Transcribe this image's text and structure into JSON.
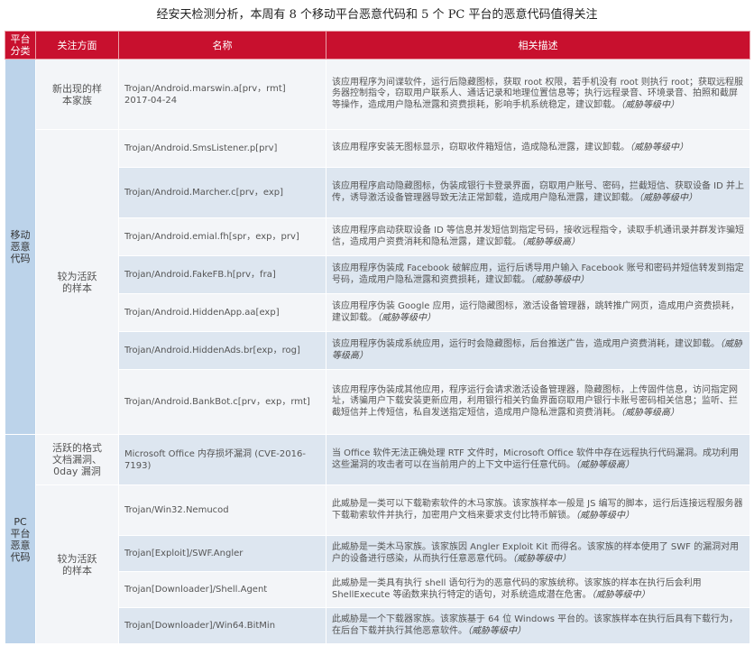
{
  "caption": "经安天检测分析，本周有 8 个移动平台恶意代码和 5 个 PC 平台的恶意代码值得关注",
  "headers": {
    "platform": "平台\n分类",
    "focus": "关注方面",
    "name": "名称",
    "desc": "相关描述"
  },
  "groups": {
    "mobile": "移动\n恶意\n代码",
    "pc": "PC\n平台\n恶意\n代码"
  },
  "focus": {
    "mobile_new": "新出现的样\n本家族",
    "mobile_active": "较为活跃\n的样本",
    "pc_vuln": "活跃的格式\n文档漏洞、\n0day 漏洞",
    "pc_active": "较为活跃\n的样本"
  },
  "rows": [
    {
      "name": "Trojan/Android.marswin.a[prv，rmt]\n2017-04-24",
      "desc": "该应用程序为间谍软件，运行后隐藏图标，获取 root 权限，若手机没有 root 则执行 root；获取远程服务器控制指令，窃取用户联系人、通话记录和地理位置信息等；执行远程录音、环境录音、拍照和截屏等操作，造成用户隐私泄露和资费损耗，影响手机系统稳定，建议卸载。",
      "level": "（威胁等级中）"
    },
    {
      "name": "Trojan/Android.SmsListener.p[prv]",
      "desc": "该应用程序安装无图标显示，窃取收件箱短信，造成隐私泄露，建议卸载。",
      "level": "（威胁等级中）"
    },
    {
      "name": "Trojan/Android.Marcher.c[prv，exp]",
      "desc": "该应用程序启动隐藏图标，伪装成银行卡登录界面，窃取用户账号、密码，拦截短信、获取设备 ID 并上传，诱导激活设备管理器导致无法正常卸载，造成用户隐私泄露，建议卸载。",
      "level": "（威胁等级中）"
    },
    {
      "name": "Trojan/Android.emial.fh[spr，exp，prv]",
      "desc": "该应用程序启动获取设备 ID 等信息并发短信到指定号码，接收远程指令，读取手机通讯录并群发诈骗短信，造成用户资费消耗和隐私泄露，建议卸载。",
      "level": "（威胁等级高）"
    },
    {
      "name": "Trojan/Android.FakeFB.h[prv，fra]",
      "desc": "该应用程序伪装成 Facebook 破解应用，运行后诱导用户输入 Facebook 账号和密码并短信转发到指定号码，造成用户隐私泄露和资费损耗，建议卸载。",
      "level": "（威胁等级中）"
    },
    {
      "name": "Trojan/Android.HiddenApp.aa[exp]",
      "desc": "该应用程序伪装 Google 应用，运行隐藏图标，激活设备管理器，跳转推广网页，造成用户资费损耗，建议卸载。",
      "level": "（威胁等级中）"
    },
    {
      "name": "Trojan/Android.HiddenAds.br[exp，rog]",
      "desc": "该应用程序伪装成系统应用，运行时会隐藏图标，后台推送广告，造成用户资费消耗，建议卸载。",
      "level": "（威胁等级高）"
    },
    {
      "name": "Trojan/Android.BankBot.c[prv，exp，rmt]",
      "desc": "该应用程序伪装成其他应用，程序运行会请求激活设备管理器，隐藏图标，上传固件信息，访问指定网址，诱骗用户下载安装更新应用，利用银行相关钓鱼界面窃取用户银行卡账号密码相关信息；监听、拦截短信并上传短信，私自发送指定短信，造成用户隐私泄露和资费消耗。",
      "level": "（威胁等级高）"
    },
    {
      "name": "Microsoft Office 内存损坏漏洞 (CVE-2016-7193)",
      "desc": "当 Office 软件无法正确处理 RTF 文件时，Microsoft Office 软件中存在远程执行代码漏洞。成功利用这些漏洞的攻击者可以在当前用户的上下文中运行任意代码。",
      "level": "（威胁等级高）"
    },
    {
      "name": "Trojan/Win32.Nemucod",
      "desc": "此威胁是一类可以下载勒索软件的木马家族。该家族样本一般是 JS 编写的脚本，运行后连接远程服务器下载勒索软件并执行，加密用户文档来要求支付比特币解锁。",
      "level": "（威胁等级中）"
    },
    {
      "name": "Trojan[Exploit]/SWF.Angler",
      "desc": "此威胁是一类木马家族。该家族因 Angler Exploit Kit 而得名。该家族的样本使用了 SWF 的漏洞对用户的设备进行感染，从而执行任意恶意代码。",
      "level": "（威胁等级中）"
    },
    {
      "name": "Trojan[Downloader]/Shell.Agent",
      "desc": "此威胁是一类具有执行 shell 语句行为的恶意代码的家族统称。该家族的样本在执行后会利用 ShellExecute 等函数来执行特定的语句，对系统造成潜在危害。",
      "level": "（威胁等级中）"
    },
    {
      "name": "Trojan[Downloader]/Win64.BitMin",
      "desc": "此威胁是一个下载器家族。该家族基于 64 位 Windows 平台的。该家族样本在执行后具有下载行为，在后台下载并执行其他恶意软件。",
      "level": "（威胁等级中）"
    }
  ]
}
